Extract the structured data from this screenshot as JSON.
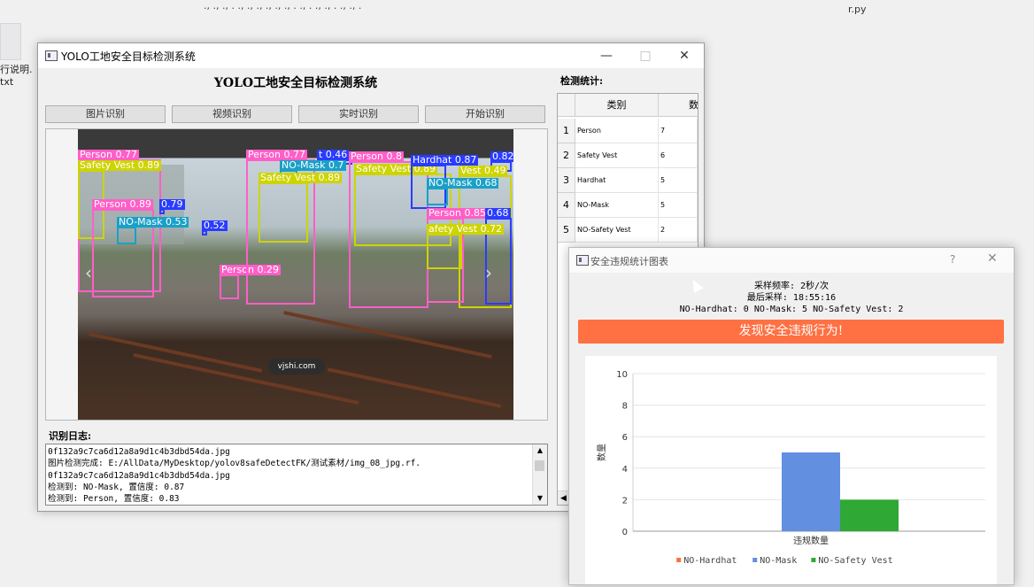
{
  "desktop": {
    "file_label": "行说明.txt",
    "file_label_line1": "行说明.",
    "file_label_line2": "txt",
    "top_strip": "., ., ., . ., ., ., ., ., ., . ., . ., ., . ., ., .",
    "right_label": "r.py"
  },
  "main_window": {
    "title": "YOLO工地安全目标检测系统",
    "heading": "YOLO工地安全目标检测系统",
    "buttons": [
      "图片识别",
      "视频识别",
      "实时识别",
      "开始识别"
    ],
    "detections": [
      {
        "label": "Person 0.77",
        "color": "#ff5fc8"
      },
      {
        "label": "Safety Vest 0.89",
        "color": "#cdd400"
      },
      {
        "label": "Person 0.89",
        "color": "#ff5fc8"
      },
      {
        "label": "0.79",
        "color": "#2a3cff"
      },
      {
        "label": "NO-Mask 0.53",
        "color": "#1aa0c8"
      },
      {
        "label": "0.52",
        "color": "#2a3cff"
      },
      {
        "label": "Person 0.29",
        "color": "#ff5fc8"
      },
      {
        "label": "Person 0.77",
        "color": "#ff5fc8"
      },
      {
        "label": "t 0.46",
        "color": "#2a3cff"
      },
      {
        "label": "NO-Mask 0.7",
        "color": "#1aa0c8"
      },
      {
        "label": "Safety Vest 0.89",
        "color": "#cdd400"
      },
      {
        "label": "Person 0.8",
        "color": "#ff5fc8"
      },
      {
        "label": "Safety Vest 0.89",
        "color": "#cdd400"
      },
      {
        "label": "Hardhat 0.87",
        "color": "#2a3cff"
      },
      {
        "label": "0.82",
        "color": "#2a3cff"
      },
      {
        "label": "Vest 0.49",
        "color": "#cdd400"
      },
      {
        "label": "NO-Mask 0.68",
        "color": "#1aa0c8"
      },
      {
        "label": "Person 0.85",
        "color": "#ff5fc8"
      },
      {
        "label": "0.68",
        "color": "#2a3cff"
      },
      {
        "label": "afety Vest 0.72",
        "color": "#cdd400"
      }
    ],
    "watermark": "vjshi.com",
    "log_label": "识别日志:",
    "log_lines": [
      "0f132a9c7ca6d12a8a9d1c4b3dbd54da.jpg",
      "图片检测完成: E:/AllData/MyDesktop/yolov8safeDetectFK/测试素材/img_08_jpg.rf.",
      "0f132a9c7ca6d12a8a9d1c4b3dbd54da.jpg",
      "检测到: NO-Mask, 置信度: 0.87",
      "检测到: Person, 置信度: 0.83"
    ],
    "stats_label": "检测统计:",
    "table": {
      "headers": [
        "类别",
        "数"
      ],
      "rows": [
        {
          "num": "1",
          "category": "Person",
          "count": "7"
        },
        {
          "num": "2",
          "category": "Safety Vest",
          "count": "6"
        },
        {
          "num": "3",
          "category": "Hardhat",
          "count": "5"
        },
        {
          "num": "4",
          "category": "NO-Mask",
          "count": "5"
        },
        {
          "num": "5",
          "category": "NO-Safety Vest",
          "count": "2"
        }
      ]
    }
  },
  "chart_dialog": {
    "title": "安全违规统计图表",
    "help": "?",
    "sampling": "采样频率: 2秒/次",
    "last_sample": "最后采样: 18:55:16",
    "summary": "NO-Hardhat: 0  NO-Mask: 5  NO-Safety Vest: 2",
    "alert": "发现安全违规行为!"
  },
  "chart_data": {
    "type": "bar",
    "categories": [
      "违规数量"
    ],
    "series": [
      {
        "name": "NO-Hardhat",
        "values": [
          0
        ],
        "color": "#ff7043"
      },
      {
        "name": "NO-Mask",
        "values": [
          5
        ],
        "color": "#628fe0"
      },
      {
        "name": "NO-Safety Vest",
        "values": [
          2
        ],
        "color": "#2fa836"
      }
    ],
    "xlabel": "",
    "ylabel": "数量",
    "ylim": [
      0,
      10
    ],
    "yticks": [
      "0",
      "2",
      "4",
      "6",
      "8",
      "10"
    ],
    "grid": true,
    "legend": "bottom"
  }
}
